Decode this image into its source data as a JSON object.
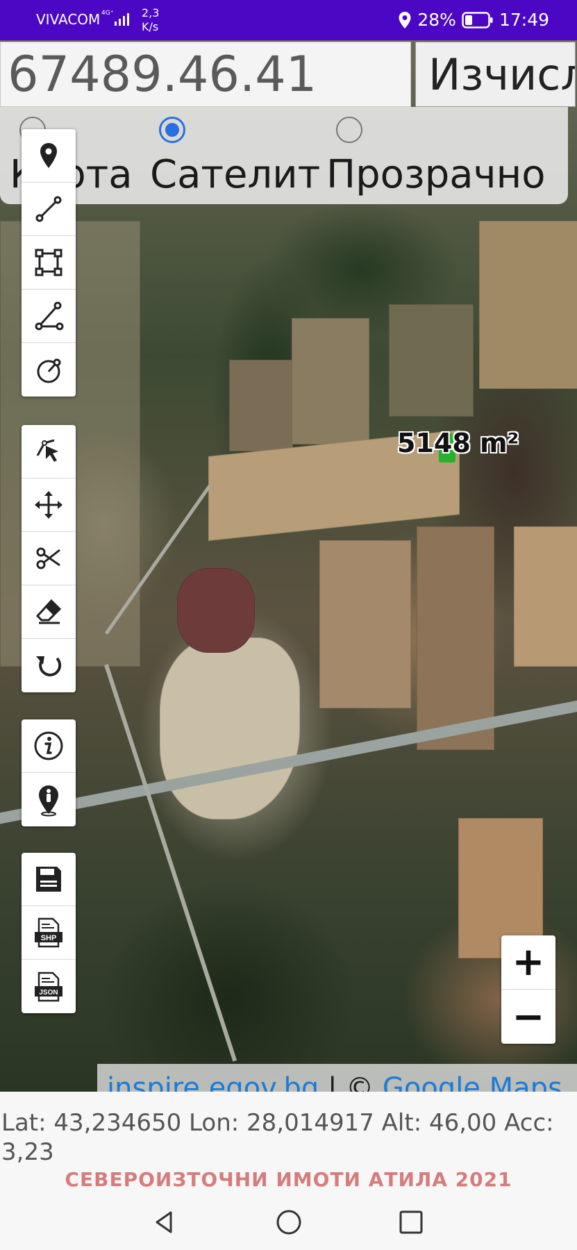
{
  "status_bar": {
    "carrier": "VIVACOM",
    "network": "4G⁺",
    "speed_value": "2,3",
    "speed_unit": "K/s",
    "battery": "28%",
    "time": "17:49"
  },
  "coord_input": {
    "value": "67489.46.41"
  },
  "calc_button": {
    "label": "Изчисли"
  },
  "map_type": {
    "options": [
      {
        "label": "Карта",
        "checked": false
      },
      {
        "label": "Сателит",
        "checked": true
      },
      {
        "label": "Прозрачно",
        "checked": false
      }
    ]
  },
  "toolbar": {
    "groups": [
      [
        "marker-icon",
        "line-icon",
        "polygon-icon",
        "angle-icon",
        "circle-icon"
      ],
      [
        "select-icon",
        "move-icon",
        "scissors-icon",
        "eraser-icon",
        "undo-icon"
      ],
      [
        "info-icon",
        "person-location-icon"
      ],
      [
        "save-icon",
        "shp-icon",
        "json-icon"
      ]
    ],
    "shp_text": "SHP",
    "json_text": "JSON"
  },
  "map": {
    "area_label": "5148 m²",
    "attribution_link1": "inspire.egov.bg",
    "attribution_sep": " | © ",
    "attribution_link2": "Google Maps"
  },
  "zoom": {
    "in": "+",
    "out": "−"
  },
  "gps_readout": "Lat: 43,234650 Lon: 28,014917 Alt: 46,00 Acc: 3,23",
  "footer_brand": "СЕВЕРОИЗТОЧНИ ИМОТИ АТИЛА 2021",
  "colors": {
    "status_bar": "#4b07c4",
    "radio_accent": "#2a6fe0",
    "brand_text": "#d47d7d",
    "area_marker": "#27b12c"
  }
}
